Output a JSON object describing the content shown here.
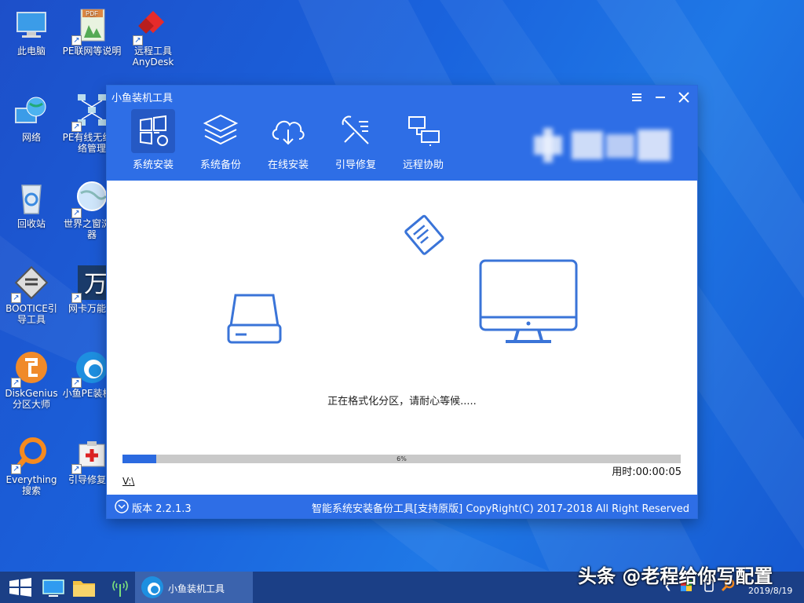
{
  "desktop": {
    "icons": [
      {
        "label": "此电脑",
        "icon": "computer-icon"
      },
      {
        "label": "PE联网等说明",
        "icon": "pdf-icon"
      },
      {
        "label": "远程工具\nAnyDesk",
        "icon": "anydesk-icon"
      },
      {
        "label": "网络",
        "icon": "network-globe-icon"
      },
      {
        "label": "PE有线无线网络管理",
        "icon": "network-manager-icon"
      },
      {
        "label": "回收站",
        "icon": "recycle-bin-icon"
      },
      {
        "label": "世界之窗浏览器",
        "icon": "browser-globe-icon"
      },
      {
        "label": "BOOTICE引导工具",
        "icon": "bootice-icon"
      },
      {
        "label": "网卡万能驱",
        "icon": "driver-wan-icon"
      },
      {
        "label": "DiskGenius分区大师",
        "icon": "diskgenius-icon"
      },
      {
        "label": "小鱼PE装机具",
        "icon": "xiaoyu-icon"
      },
      {
        "label": "Everything搜索",
        "icon": "everything-search-icon"
      },
      {
        "label": "引导修复工",
        "icon": "boot-repair-icon"
      }
    ]
  },
  "window": {
    "title": "小鱼装机工具",
    "controls": {
      "menu": "menu-icon",
      "minimize": "minimize-icon",
      "close": "close-icon"
    },
    "toolbar": [
      {
        "label": "系统安装",
        "icon": "windows-install-icon",
        "active": true
      },
      {
        "label": "系统备份",
        "icon": "layers-backup-icon",
        "active": false
      },
      {
        "label": "在线安装",
        "icon": "cloud-download-icon",
        "active": false
      },
      {
        "label": "引导修复",
        "icon": "wrench-repair-icon",
        "active": false
      },
      {
        "label": "远程协助",
        "icon": "remote-assist-icon",
        "active": false
      }
    ],
    "status_message": "正在格式化分区，请耐心等候.....",
    "progress": {
      "value": 6,
      "label": "6%"
    },
    "drive": "V:\\",
    "elapsed": "用时:00:00:05",
    "footer": {
      "version": "版本 2.2.1.3",
      "copyright": "智能系统安装备份工具[支持原版]  CopyRight(C) 2017-2018 All Right Reserved"
    },
    "accent": "#2e6ee6"
  },
  "taskbar": {
    "app_label": "小鱼装机工具",
    "date": "2019/8/19"
  },
  "watermark": "头条 @老程给你写配置"
}
